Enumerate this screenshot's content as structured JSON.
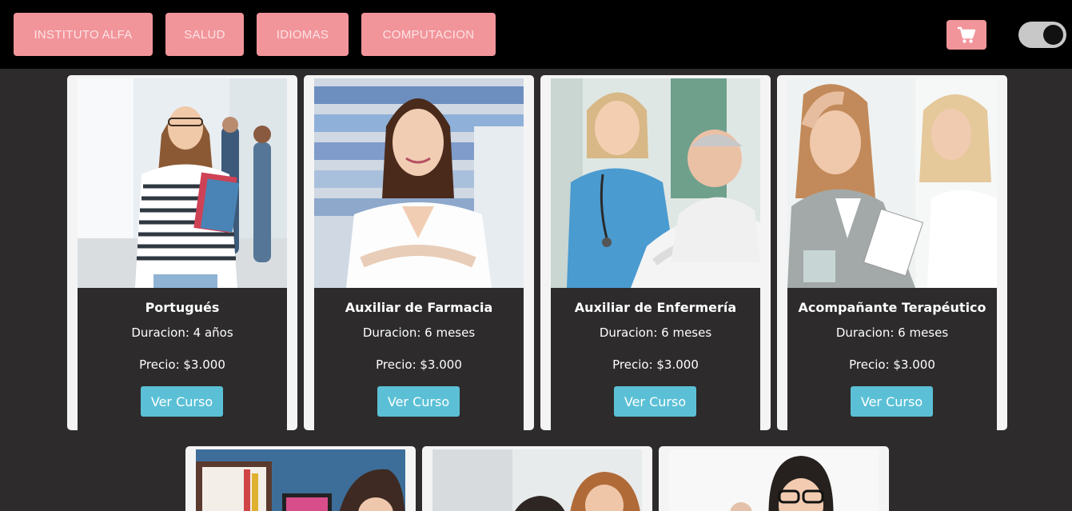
{
  "nav": {
    "items": [
      {
        "label": "INSTITUTO ALFA"
      },
      {
        "label": "SALUD"
      },
      {
        "label": "IDIOMAS"
      },
      {
        "label": "COMPUTACION"
      }
    ]
  },
  "cart": {
    "icon": "cart-icon"
  },
  "theme_toggle": {
    "state": "on"
  },
  "courses": [
    {
      "title": "Portugués",
      "duration": "Duracion: 4 años",
      "price": "Precio: $3.000",
      "button": "Ver Curso",
      "image": "student-with-books-photo"
    },
    {
      "title": "Auxiliar de Farmacia",
      "duration": "Duracion: 6 meses",
      "price": "Precio: $3.000",
      "button": "Ver Curso",
      "image": "pharmacist-photo"
    },
    {
      "title": "Auxiliar de Enfermería",
      "duration": "Duracion: 6 meses",
      "price": "Precio: $3.000",
      "button": "Ver Curso",
      "image": "nurse-with-patient-photo"
    },
    {
      "title": "Acompañante Terapéutico",
      "duration": "Duracion: 6 meses",
      "price": "Precio: $3.000",
      "button": "Ver Curso",
      "image": "therapy-session-photo"
    }
  ],
  "colors": {
    "nav_bg": "#000000",
    "page_bg": "#2d2b2b",
    "accent_pink": "#f1959a",
    "button_blue": "#5bc0d6",
    "card_border": "#f4f4f4"
  }
}
